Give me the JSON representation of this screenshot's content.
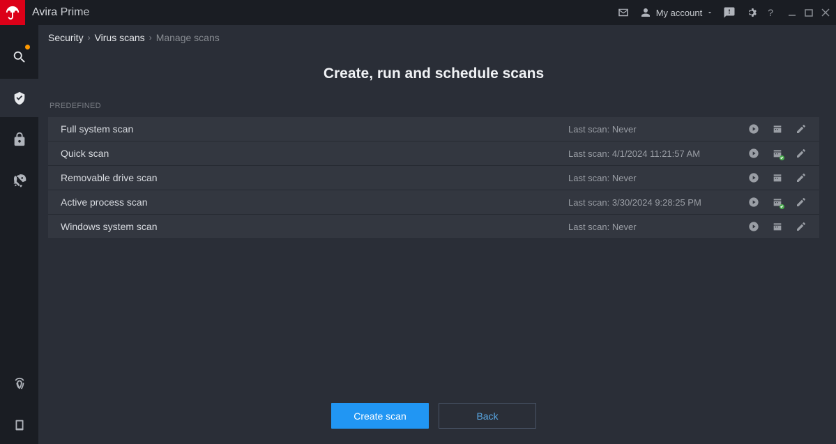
{
  "titlebar": {
    "brand": "Avira",
    "product": "Prime",
    "account_label": "My account"
  },
  "breadcrumb": {
    "items": [
      "Security",
      "Virus scans",
      "Manage scans"
    ]
  },
  "page": {
    "title": "Create, run and schedule scans",
    "section_label": "PREDEFINED"
  },
  "scans": [
    {
      "name": "Full system scan",
      "status": "Last scan: Never",
      "scheduled": false
    },
    {
      "name": "Quick scan",
      "status": "Last scan: 4/1/2024 11:21:57 AM",
      "scheduled": true
    },
    {
      "name": "Removable drive scan",
      "status": "Last scan: Never",
      "scheduled": false
    },
    {
      "name": "Active process scan",
      "status": "Last scan: 3/30/2024 9:28:25 PM",
      "scheduled": true
    },
    {
      "name": "Windows system scan",
      "status": "Last scan: Never",
      "scheduled": false
    }
  ],
  "footer": {
    "create_label": "Create scan",
    "back_label": "Back"
  }
}
